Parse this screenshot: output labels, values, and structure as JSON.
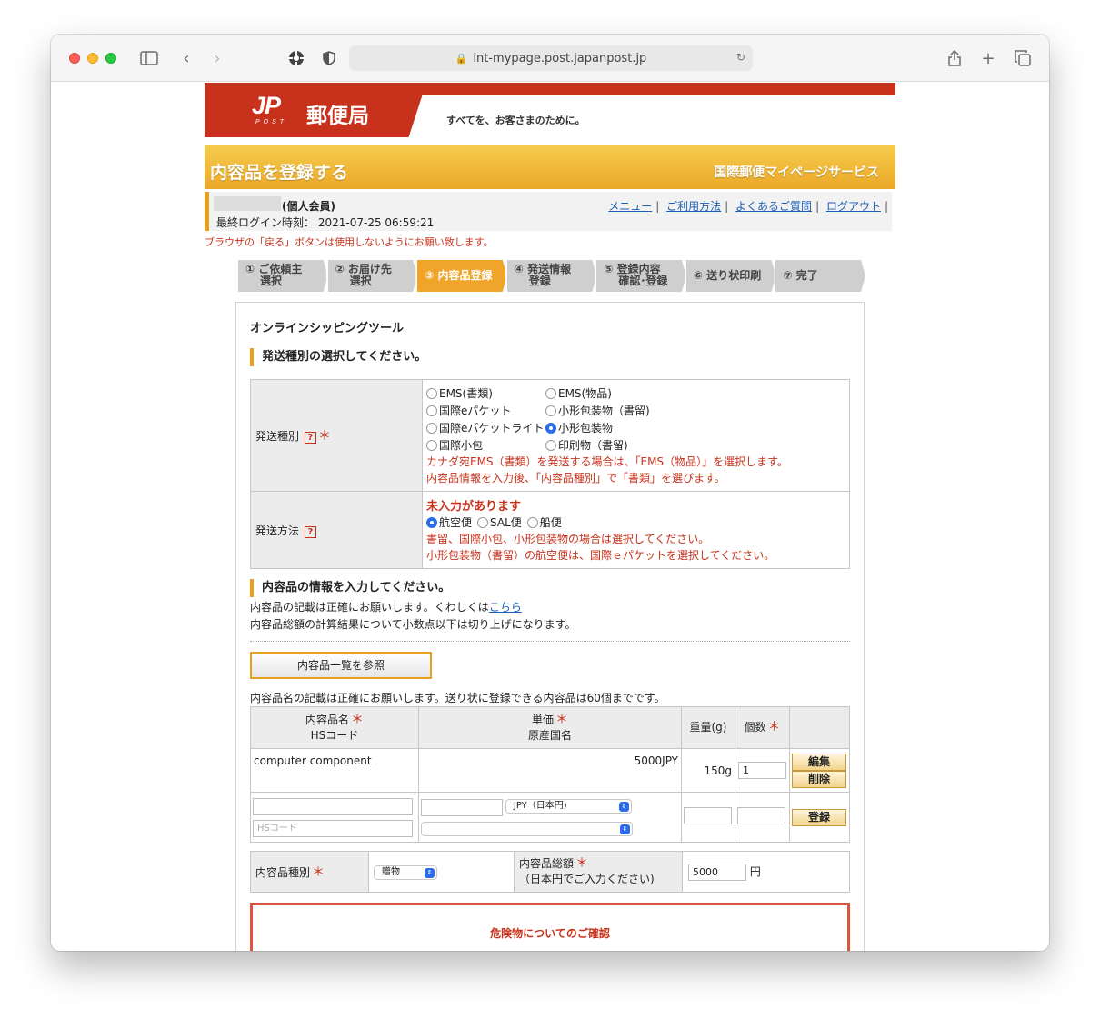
{
  "browser": {
    "url": "int-mypage.post.japanpost.jp"
  },
  "brand": {
    "jp": "JP",
    "post": "POST",
    "name": "郵便局",
    "slogan": "すべてを、お客さまのために。"
  },
  "banner": {
    "title": "内容品を登録する",
    "service": "国際郵便マイページサービス"
  },
  "member": {
    "type": "(個人会員)",
    "last_login_label": "最終ログイン時刻：",
    "last_login_value": "2021-07-25 06:59:21",
    "links": [
      "メニュー",
      "ご利用方法",
      "よくあるご質問",
      "ログアウト"
    ]
  },
  "back_warning": "ブラウザの「戻る」ボタンは使用しないようにお願い致します。",
  "steps": [
    {
      "line1": "① ご依頼主",
      "line2": "選択"
    },
    {
      "line1": "② お届け先",
      "line2": "選択"
    },
    {
      "line1": "③ 内容品登録",
      "line2": ""
    },
    {
      "line1": "④ 発送情報",
      "line2": "登録"
    },
    {
      "line1": "⑤ 登録内容",
      "line2": "確認･登録"
    },
    {
      "line1": "⑥ 送り状印刷",
      "line2": ""
    },
    {
      "line1": "⑦ 完了",
      "line2": ""
    }
  ],
  "tool_title": "オンラインシッピングツール",
  "shipping": {
    "heading": "発送種別の選択してください。",
    "type_label": "発送種別",
    "method_label": "発送方法",
    "help_mark": "?",
    "required_mark": "＊",
    "options": [
      [
        "EMS(書類)",
        "EMS(物品)"
      ],
      [
        "国際eパケット",
        "小形包装物（書留)"
      ],
      [
        "国際eパケットライト",
        "小形包装物"
      ],
      [
        "国際小包",
        "印刷物（書留)"
      ]
    ],
    "selected_type": "小形包装物",
    "type_notes": [
      "カナダ宛EMS（書類）を発送する場合は、「EMS（物品）」を選択します。",
      "内容品情報を入力後、「内容品種別」で「書類」を選びます。"
    ],
    "method_error": "未入力があります",
    "methods": [
      "航空便",
      "SAL便",
      "船便"
    ],
    "selected_method": "航空便",
    "method_notes": [
      "書留、国際小包、小形包装物の場合は選択してください。",
      "小形包装物（書留）の航空便は、国際ｅパケットを選択してください。"
    ]
  },
  "contents": {
    "heading": "内容品の情報を入力してください。",
    "note1_pre": "内容品の記載は正確にお願いします。くわしくは",
    "note1_link": "こちら",
    "note2": "内容品総額の計算結果について小数点以下は切り上げになります。",
    "browse_button": "内容品一覧を参照",
    "limit_note": "内容品名の記載は正確にお願いします。送り状に登録できる内容品は60個までです。",
    "headers": {
      "name": "内容品名",
      "hs": "HSコード",
      "price": "単価",
      "origin": "原産国名",
      "weight": "重量(g)",
      "qty": "個数"
    },
    "row": {
      "name": "computer component",
      "price": "5000JPY",
      "weight": "150g",
      "qty": "1",
      "edit": "編集",
      "delete": "削除"
    },
    "new_row": {
      "hs_placeholder": "HSコード",
      "currency": "JPY（日本円)",
      "origin": "",
      "register": "登録"
    },
    "category_label": "内容品種別",
    "category_value": "贈物",
    "total_label": "内容品総額",
    "total_sub": "（日本円でご入力ください)",
    "total_value": "5000",
    "total_unit": "円"
  },
  "danger": {
    "title": "危険物についてのご確認"
  },
  "colors": {
    "brand_red": "#c8321c",
    "accent_orange": "#e8a020",
    "link_blue": "#1a5fb4"
  }
}
